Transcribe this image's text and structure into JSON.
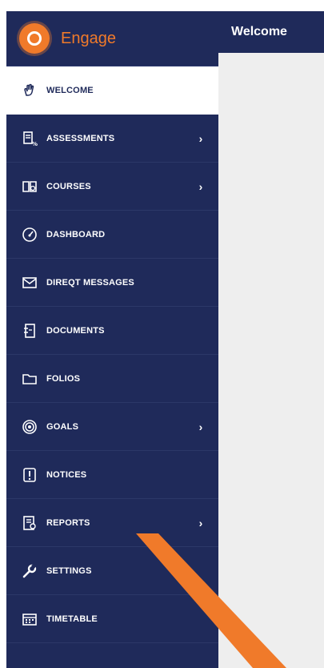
{
  "brand": {
    "name": "Engage",
    "logo_icon": "engage-logo-icon"
  },
  "header": {
    "title": "Welcome"
  },
  "colors": {
    "sidebar": "#1f2a5a",
    "accent": "#f07a2a",
    "content": "#eeeeee"
  },
  "nav": [
    {
      "label": "WELCOME",
      "icon": "hand-wave-icon",
      "active": true,
      "chevron": ""
    },
    {
      "label": "ASSESSMENTS",
      "icon": "assessment-icon",
      "active": false,
      "chevron": "›"
    },
    {
      "label": "COURSES",
      "icon": "book-icon",
      "active": false,
      "chevron": "›"
    },
    {
      "label": "DASHBOARD",
      "icon": "gauge-icon",
      "active": false,
      "chevron": ""
    },
    {
      "label": "DIREQT MESSAGES",
      "icon": "mail-icon",
      "active": false,
      "chevron": ""
    },
    {
      "label": "DOCUMENTS",
      "icon": "document-icon",
      "active": false,
      "chevron": ""
    },
    {
      "label": "FOLIOS",
      "icon": "folder-icon",
      "active": false,
      "chevron": ""
    },
    {
      "label": "GOALS",
      "icon": "target-icon",
      "active": false,
      "chevron": "›"
    },
    {
      "label": "NOTICES",
      "icon": "notice-icon",
      "active": false,
      "chevron": ""
    },
    {
      "label": "REPORTS",
      "icon": "report-icon",
      "active": false,
      "chevron": "›"
    },
    {
      "label": "SETTINGS",
      "icon": "wrench-icon",
      "active": false,
      "chevron": ""
    },
    {
      "label": "TIMETABLE",
      "icon": "calendar-icon",
      "active": false,
      "chevron": ""
    }
  ]
}
